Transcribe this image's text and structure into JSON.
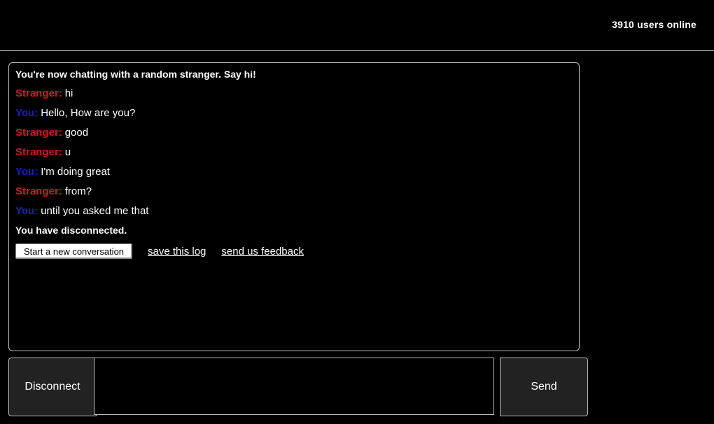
{
  "header": {
    "users_online": "3910 users online"
  },
  "chat": {
    "intro": "You're now chatting with a random stranger. Say hi!",
    "messages": [
      {
        "sender": "Stranger:",
        "role": "stranger",
        "text": "hi"
      },
      {
        "sender": "You:",
        "role": "you",
        "text": "Hello, How are you?"
      },
      {
        "sender": "Stranger:",
        "role": "stranger",
        "text": "good"
      },
      {
        "sender": "Stranger:",
        "role": "stranger",
        "text": "u"
      },
      {
        "sender": "You:",
        "role": "you",
        "text": "I'm doing great"
      },
      {
        "sender": "Stranger:",
        "role": "stranger",
        "text": "from?"
      },
      {
        "sender": "You:",
        "role": "you",
        "text": "until you asked me that"
      }
    ],
    "status": "You have disconnected.",
    "new_conversation_label": "Start a new conversation",
    "save_log_label": "save this log",
    "feedback_label": "send us feedback"
  },
  "controls": {
    "disconnect_label": "Disconnect",
    "send_label": "Send",
    "message_value": "",
    "message_placeholder": ""
  },
  "colors": {
    "stranger": "#d21a1a",
    "you": "#1a1ad2",
    "background": "#000000"
  }
}
